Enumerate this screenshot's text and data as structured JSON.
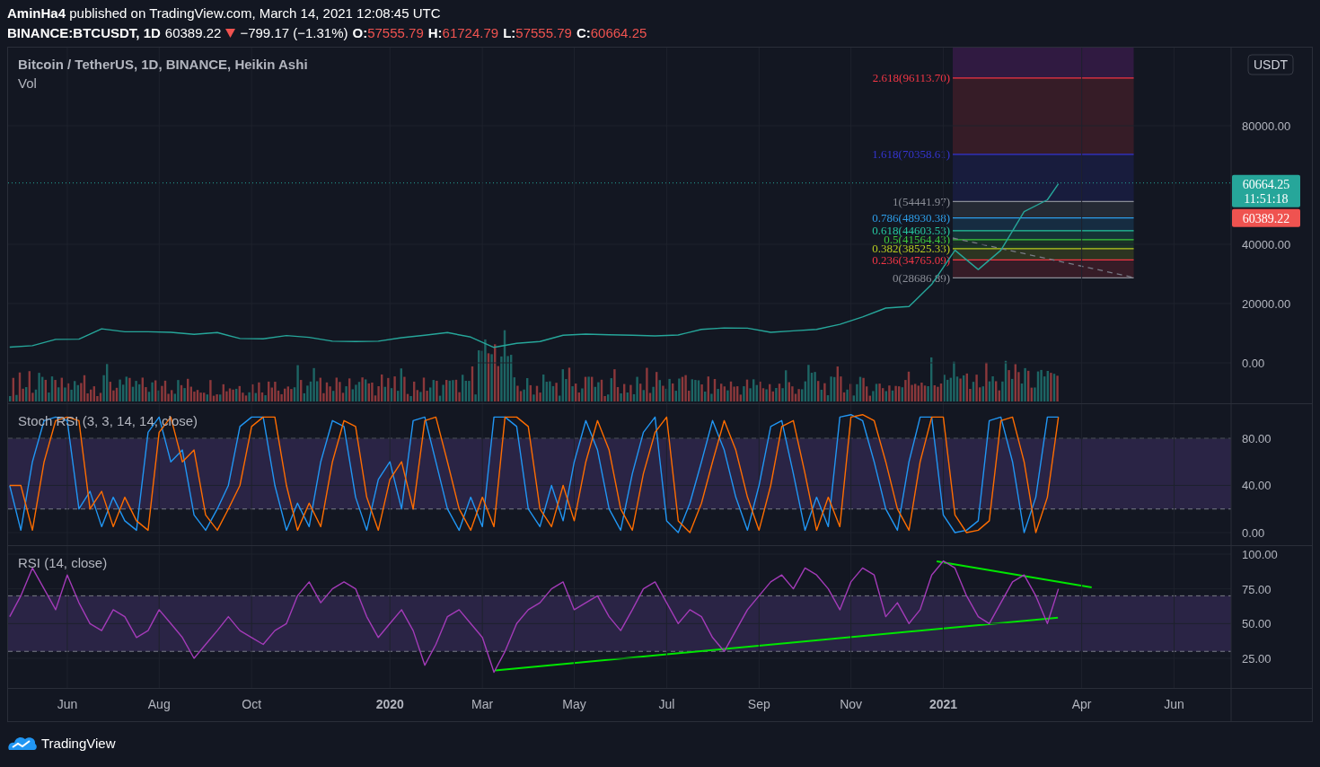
{
  "published_line": "**AminHa4** published on TradingView.com, March 14, 2021 12:08:45 UTC",
  "symbol_bar": {
    "symbol": "BINANCE:BTCUSDT, 1D",
    "price": "60389.22",
    "change_down": true,
    "change": "−799.17 (−1.31%)",
    "ohlc": [
      {
        "label": "O:",
        "value": "57555.79"
      },
      {
        "label": "H:",
        "value": "61724.79"
      },
      {
        "label": "L:",
        "value": "57555.79"
      },
      {
        "label": "C:",
        "value": "60664.25"
      }
    ]
  },
  "panes": [
    {
      "kind": "price",
      "legend": [
        "Bitcoin / TetherUS, 1D, BINANCE, Heikin Ashi",
        "Vol"
      ],
      "currency_badge": "USDT",
      "price_tags": [
        {
          "label": "60664.25",
          "sublabel": "11:51:18",
          "color": "#26a69a"
        },
        {
          "label": "60389.22",
          "color": "#ef5350"
        }
      ],
      "chart_data": {
        "type": "line",
        "x": [
          2019.313,
          2019.354,
          2019.396,
          2019.438,
          2019.479,
          2019.521,
          2019.563,
          2019.604,
          2019.646,
          2019.688,
          2019.729,
          2019.771,
          2019.813,
          2019.854,
          2019.896,
          2019.938,
          2019.979,
          2020.021,
          2020.063,
          2020.104,
          2020.146,
          2020.188,
          2020.229,
          2020.271,
          2020.313,
          2020.354,
          2020.396,
          2020.438,
          2020.479,
          2020.521,
          2020.563,
          2020.604,
          2020.646,
          2020.688,
          2020.729,
          2020.771,
          2020.813,
          2020.854,
          2020.896,
          2020.938,
          2020.979,
          2021.021,
          2021.063,
          2021.104,
          2021.146,
          2021.188,
          2021.208
        ],
        "series": [
          {
            "color": "#26a69a",
            "values": [
              5300,
              5800,
              7900,
              8000,
              11500,
              10500,
              10500,
              10300,
              9600,
              10200,
              8200,
              8100,
              9200,
              8600,
              7300,
              7200,
              7300,
              8500,
              9300,
              10200,
              8700,
              5200,
              6600,
              7200,
              9300,
              9700,
              9500,
              9300,
              9100,
              9400,
              11300,
              11800,
              11700,
              10300,
              10800,
              11300,
              13000,
              15500,
              18500,
              19000,
              26500,
              38000,
              31500,
              38000,
              51000,
              55000,
              60389
            ]
          }
        ],
        "xlim": [
          2019.31,
          2021.666
        ],
        "ylim": [
          -13636,
          106364
        ],
        "grid": true,
        "yticks": [
          {
            "value": 0,
            "label": "0.00"
          },
          {
            "value": 20000,
            "label": "20000.00"
          },
          {
            "value": 40000,
            "label": "40000.00"
          },
          {
            "value": 80000,
            "label": "80000.00"
          }
        ]
      },
      "fib_levels": [
        {
          "label": "2.618(96113.70)",
          "color": "#f23645"
        },
        {
          "label": "1.618(70358.61)",
          "color": "#3535d0"
        },
        {
          "label": "1(54441.97)",
          "color": "#8a8d96"
        },
        {
          "label": "0.786(48930.38)",
          "color": "#2d9de8"
        },
        {
          "label": "0.618(44603.53)",
          "color": "#26c6a0"
        },
        {
          "label": "0.5(41564.43)",
          "color": "#3cc83c"
        },
        {
          "label": "0.382(38525.33)",
          "color": "#b8cc20"
        },
        {
          "label": "0.236(34765.09)",
          "color": "#f23645"
        },
        {
          "label": "0(28686.89)",
          "color": "#8a8d96"
        }
      ]
    },
    {
      "kind": "stoch",
      "legend": [
        "Stoch RSI (3, 3, 14, 14, close)"
      ],
      "chart_data": {
        "type": "line",
        "x": [
          2019.313,
          2019.333,
          2019.354,
          2019.375,
          2019.396,
          2019.417,
          2019.438,
          2019.458,
          2019.479,
          2019.5,
          2019.521,
          2019.542,
          2019.563,
          2019.583,
          2019.604,
          2019.625,
          2019.646,
          2019.667,
          2019.688,
          2019.708,
          2019.729,
          2019.75,
          2019.771,
          2019.792,
          2019.813,
          2019.833,
          2019.854,
          2019.875,
          2019.896,
          2019.917,
          2019.938,
          2019.958,
          2019.979,
          2020.0,
          2020.021,
          2020.042,
          2020.063,
          2020.083,
          2020.104,
          2020.125,
          2020.146,
          2020.167,
          2020.188,
          2020.208,
          2020.229,
          2020.25,
          2020.271,
          2020.292,
          2020.313,
          2020.333,
          2020.354,
          2020.375,
          2020.396,
          2020.417,
          2020.438,
          2020.458,
          2020.479,
          2020.5,
          2020.521,
          2020.542,
          2020.563,
          2020.583,
          2020.604,
          2020.625,
          2020.646,
          2020.667,
          2020.688,
          2020.708,
          2020.729,
          2020.75,
          2020.771,
          2020.792,
          2020.813,
          2020.833,
          2020.854,
          2020.875,
          2020.896,
          2020.917,
          2020.938,
          2020.958,
          2020.979,
          2021.0,
          2021.021,
          2021.042,
          2021.063,
          2021.083,
          2021.104,
          2021.125,
          2021.146,
          2021.167,
          2021.188,
          2021.208
        ],
        "series": [
          {
            "color": "#2196f3",
            "values": [
              40,
              2,
              60,
              95,
              98,
              95,
              20,
              35,
              5,
              30,
              10,
              2,
              85,
              98,
              60,
              70,
              15,
              2,
              20,
              40,
              90,
              98,
              98,
              40,
              2,
              25,
              5,
              60,
              95,
              90,
              30,
              2,
              45,
              60,
              20,
              95,
              98,
              60,
              20,
              2,
              30,
              5,
              98,
              98,
              90,
              20,
              5,
              40,
              10,
              60,
              95,
              70,
              20,
              2,
              50,
              85,
              98,
              10,
              0,
              25,
              60,
              95,
              70,
              30,
              2,
              40,
              90,
              95,
              50,
              2,
              30,
              5,
              98,
              100,
              95,
              60,
              20,
              2,
              60,
              98,
              98,
              15,
              0,
              2,
              10,
              95,
              98,
              60,
              0,
              30,
              98,
              98
            ]
          },
          {
            "color": "#ff6d00",
            "values": [
              40,
              40,
              2,
              60,
              95,
              98,
              95,
              20,
              35,
              5,
              30,
              10,
              2,
              85,
              98,
              60,
              70,
              15,
              2,
              20,
              40,
              90,
              98,
              98,
              40,
              2,
              25,
              5,
              60,
              95,
              90,
              30,
              2,
              45,
              60,
              20,
              95,
              98,
              60,
              20,
              2,
              30,
              5,
              98,
              98,
              90,
              20,
              5,
              40,
              10,
              60,
              95,
              70,
              20,
              2,
              50,
              85,
              98,
              10,
              0,
              25,
              60,
              95,
              70,
              30,
              2,
              40,
              90,
              95,
              50,
              2,
              30,
              5,
              98,
              100,
              95,
              60,
              20,
              2,
              60,
              98,
              98,
              15,
              0,
              2,
              10,
              95,
              98,
              60,
              0,
              30,
              98
            ]
          }
        ],
        "xlim": [
          2019.31,
          2021.666
        ],
        "ylim": [
          -10.67,
          108.95
        ],
        "grid": true,
        "yticks": [
          {
            "value": 0,
            "label": "0.00"
          },
          {
            "value": 40,
            "label": "40.00"
          },
          {
            "value": 80,
            "label": "80.00"
          }
        ]
      }
    },
    {
      "kind": "rsi",
      "legend": [
        "RSI (14, close)"
      ],
      "chart_data": {
        "type": "line",
        "x": [
          2019.313,
          2019.333,
          2019.354,
          2019.375,
          2019.396,
          2019.417,
          2019.438,
          2019.458,
          2019.479,
          2019.5,
          2019.521,
          2019.542,
          2019.563,
          2019.583,
          2019.604,
          2019.625,
          2019.646,
          2019.667,
          2019.688,
          2019.708,
          2019.729,
          2019.75,
          2019.771,
          2019.792,
          2019.813,
          2019.833,
          2019.854,
          2019.875,
          2019.896,
          2019.917,
          2019.938,
          2019.958,
          2019.979,
          2020.0,
          2020.021,
          2020.042,
          2020.063,
          2020.083,
          2020.104,
          2020.125,
          2020.146,
          2020.167,
          2020.188,
          2020.208,
          2020.229,
          2020.25,
          2020.271,
          2020.292,
          2020.313,
          2020.333,
          2020.354,
          2020.375,
          2020.396,
          2020.417,
          2020.438,
          2020.458,
          2020.479,
          2020.5,
          2020.521,
          2020.542,
          2020.563,
          2020.583,
          2020.604,
          2020.625,
          2020.646,
          2020.667,
          2020.688,
          2020.708,
          2020.729,
          2020.75,
          2020.771,
          2020.792,
          2020.813,
          2020.833,
          2020.854,
          2020.875,
          2020.896,
          2020.917,
          2020.938,
          2020.958,
          2020.979,
          2021.0,
          2021.021,
          2021.042,
          2021.063,
          2021.083,
          2021.104,
          2021.125,
          2021.146,
          2021.167,
          2021.188,
          2021.208
        ],
        "series": [
          {
            "color": "#a33bb8",
            "values": [
              55,
              70,
              90,
              75,
              60,
              85,
              65,
              50,
              45,
              60,
              55,
              40,
              45,
              60,
              50,
              40,
              25,
              35,
              45,
              55,
              45,
              40,
              35,
              45,
              50,
              70,
              80,
              65,
              75,
              80,
              75,
              55,
              40,
              50,
              60,
              45,
              20,
              35,
              55,
              60,
              50,
              40,
              15,
              30,
              50,
              60,
              65,
              75,
              80,
              60,
              65,
              70,
              55,
              45,
              60,
              75,
              80,
              65,
              50,
              60,
              55,
              40,
              30,
              45,
              60,
              70,
              80,
              85,
              75,
              90,
              85,
              75,
              60,
              80,
              90,
              85,
              55,
              65,
              50,
              60,
              85,
              95,
              90,
              70,
              55,
              50,
              65,
              80,
              85,
              70,
              50,
              75
            ]
          }
        ],
        "xlim": [
          2019.31,
          2021.666
        ],
        "ylim": [
          -20.25,
          105.8
        ],
        "grid": true,
        "xticks": [
          {
            "value": 2019.417,
            "label": "Jun"
          },
          {
            "value": 2019.583,
            "label": "Aug"
          },
          {
            "value": 2019.75,
            "label": "Oct"
          },
          {
            "value": 2020,
            "label": "2020"
          },
          {
            "value": 2020.167,
            "label": "Mar"
          },
          {
            "value": 2020.333,
            "label": "May"
          },
          {
            "value": 2020.5,
            "label": "Jul"
          },
          {
            "value": 2020.667,
            "label": "Sep"
          },
          {
            "value": 2020.833,
            "label": "Nov"
          },
          {
            "value": 2021,
            "label": "2021"
          },
          {
            "value": 2021.25,
            "label": "Apr"
          },
          {
            "value": 2021.417,
            "label": "Jun"
          }
        ],
        "yticks": [
          {
            "value": 25,
            "label": "25.00"
          },
          {
            "value": 50,
            "label": "50.00"
          },
          {
            "value": 75,
            "label": "75.00"
          },
          {
            "value": 100,
            "label": "100.00"
          }
        ]
      }
    }
  ],
  "footer": {
    "brand": "TradingView"
  }
}
